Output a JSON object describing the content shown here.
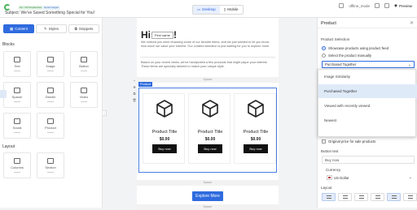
{
  "topbar": {
    "badge_green": "Go / 10 Frequencies",
    "badge_blue": "Good Images",
    "subject": "Subject: We've Saved Something Special for You!",
    "view_desktop": "Desktop",
    "view_mobile": "Mobile",
    "status": "offline_mode",
    "preview": "Preview"
  },
  "left": {
    "tabs": [
      {
        "label": "Content"
      },
      {
        "label": "Styles"
      },
      {
        "label": "Snippets"
      }
    ],
    "blocks_title": "Blocks",
    "blocks": [
      {
        "label": "Text"
      },
      {
        "label": "Image"
      },
      {
        "label": "Button"
      },
      {
        "label": "Spacer"
      },
      {
        "label": "Divider"
      },
      {
        "label": "Video"
      },
      {
        "label": "Social"
      },
      {
        "label": "Product"
      }
    ],
    "layout_title": "Layout",
    "layouts": [
      {
        "label": "Columns"
      },
      {
        "label": "Section"
      }
    ]
  },
  "email": {
    "greeting": "Hi",
    "merge_tag": "First name",
    "exclaim": "!",
    "para1": "We noticed you were browsing some of our favorite items, and we just wanted to let you know how much we value your interest. Our curated selection is just waiting for you to explore more.",
    "para2": "Based on your recent views, we've handpicked a few products that might pique your interest. These items are specially tailored to match your unique style.",
    "spacer_label": "Spacer",
    "product_tag": "Product",
    "products": [
      {
        "title": "Product Title",
        "price": "$0.00",
        "button": "Buy now"
      },
      {
        "title": "Product Title",
        "price": "$0.00",
        "button": "Buy now"
      },
      {
        "title": "Product Title",
        "price": "$0.00",
        "button": "Buy now"
      }
    ],
    "cta": "Explore More"
  },
  "right": {
    "title": "Product",
    "section_label": "Product Selection",
    "radio_feed": "Showcase products using product feed",
    "radio_manual": "Select the product manually",
    "select_value": "Purchased Together",
    "options": [
      "Image Similarity",
      "Purchased Together",
      "Viewed with recently viewed",
      "Newest"
    ],
    "selected_option_index": 1,
    "checks": [
      {
        "label": "Title",
        "checked": true
      },
      {
        "label": "Description",
        "checked": false
      },
      {
        "label": "Price",
        "checked": true
      },
      {
        "label": "Original price for sale products",
        "checked": false
      }
    ],
    "button_text_label": "Button text",
    "button_text_value": "Buy now",
    "currency_label": "Currency",
    "currency_value": "US Dollar",
    "layout_label": "Layout"
  },
  "colors": {
    "accent": "#2f6bde",
    "buy_button": "#111111",
    "canvas_bg": "#f2f3f5"
  }
}
